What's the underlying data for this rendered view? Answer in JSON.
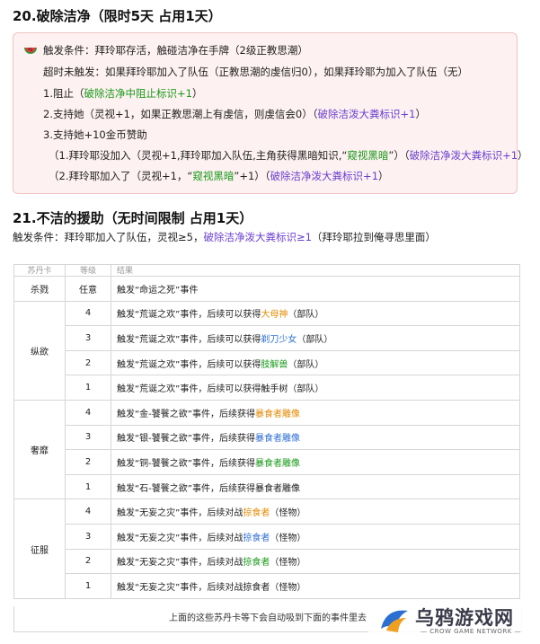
{
  "section20": {
    "title": "20.破除洁净（限时5天 占用1天）",
    "box": {
      "icon": "watermelon-icon",
      "l1": "触发条件：拜玲耶存活，触碰洁净在手牌（2级正教思潮）",
      "l2": "超时未触发：如果拜玲耶加入了队伍（正教思潮的虔信归0），如果拜玲耶为加入了队伍（无）",
      "l3a": "1.阻止（",
      "l3b": "破除洁净中阻止标识+1",
      "l3c": "）",
      "l4a": "2.支持她（灵视+1，如果正教思潮上有虔信，则虔信会0）（",
      "l4b": "破除洁泼大粪标识+1",
      "l4c": "）",
      "l5": "3.支持她+10金币赞助",
      "l6a": "（1.拜玲耶没加入（灵视+1,拜玲耶加入队伍,主角获得黑暗知识,“",
      "l6b": "窥视黑暗",
      "l6c": "”）（",
      "l6d": "破除洁净泼大粪标识+1",
      "l6e": "）",
      "l7a": "（2.拜玲耶加入了（灵视+1，“",
      "l7b": "窥视黑暗",
      "l7c": "”+1）（",
      "l7d": "破除洁净泼大粪标识+1",
      "l7e": "）"
    }
  },
  "section21": {
    "title": "21.不洁的援助（无时间限制 占用1天）",
    "cond_a": "触发条件：拜玲耶加入了队伍，灵视≥5，",
    "cond_b": "破除洁净泼大粪标识≥1",
    "cond_c": "（拜玲耶拉到俺寻思里面）"
  },
  "table": {
    "header": [
      "苏丹卡",
      "等级",
      "结果"
    ],
    "colors": {
      "orange": "#e68a00",
      "blue": "#2f6fd6",
      "green": "#1a9a1a"
    },
    "rows": [
      {
        "card": "杀戮",
        "level": "任意",
        "pre": "触发“命运之死”事件",
        "hl": "",
        "post": "",
        "color": ""
      },
      {
        "card": "纵欲",
        "level": "4",
        "pre": "触发“荒诞之欢”事件，后续可以获得",
        "hl": "大母神",
        "post": "（部队）",
        "color": "orange"
      },
      {
        "card": "",
        "level": "3",
        "pre": "触发“荒诞之欢”事件，后续可以获得",
        "hl": "剃刀少女",
        "post": "（部队）",
        "color": "blue"
      },
      {
        "card": "",
        "level": "2",
        "pre": "触发“荒诞之欢”事件，后续可以获得",
        "hl": "肢解兽",
        "post": "（部队）",
        "color": "green"
      },
      {
        "card": "",
        "level": "1",
        "pre": "触发“荒诞之欢”事件，后续可以获得触手树（部队）",
        "hl": "",
        "post": "",
        "color": ""
      },
      {
        "card": "奢靡",
        "level": "4",
        "pre": "触发“金-饕餮之欲”事件，后续获得",
        "hl": "暴食者雕像",
        "post": "",
        "color": "orange"
      },
      {
        "card": "",
        "level": "3",
        "pre": "触发“银-饕餮之欲”事件，后续获得",
        "hl": "暴食者雕像",
        "post": "",
        "color": "blue"
      },
      {
        "card": "",
        "level": "2",
        "pre": "触发“铜-饕餮之欲”事件，后续获得",
        "hl": "暴食者雕像",
        "post": "",
        "color": "green"
      },
      {
        "card": "",
        "level": "1",
        "pre": "触发“石-饕餮之欲”事件，后续获得暴食者雕像",
        "hl": "",
        "post": "",
        "color": ""
      },
      {
        "card": "征服",
        "level": "4",
        "pre": "触发“无妄之灾”事件，后续对战",
        "hl": "掠食者",
        "post": "（怪物）",
        "color": "orange"
      },
      {
        "card": "",
        "level": "3",
        "pre": "触发“无妄之灾”事件，后续对战",
        "hl": "掠食者",
        "post": "（怪物）",
        "color": "blue"
      },
      {
        "card": "",
        "level": "2",
        "pre": "触发“无妄之灾”事件，后续对战",
        "hl": "掠食者",
        "post": "（怪物）",
        "color": "green"
      },
      {
        "card": "",
        "level": "1",
        "pre": "触发“无妄之灾”事件，后续对战掠食者（怪物）",
        "hl": "",
        "post": "",
        "color": ""
      }
    ],
    "footer": "上面的这些苏丹卡等下会自动吸到下面的事件里去"
  },
  "logo": {
    "name": "乌鸦游戏网",
    "sub": "— CROW GAME NETWORK —"
  }
}
